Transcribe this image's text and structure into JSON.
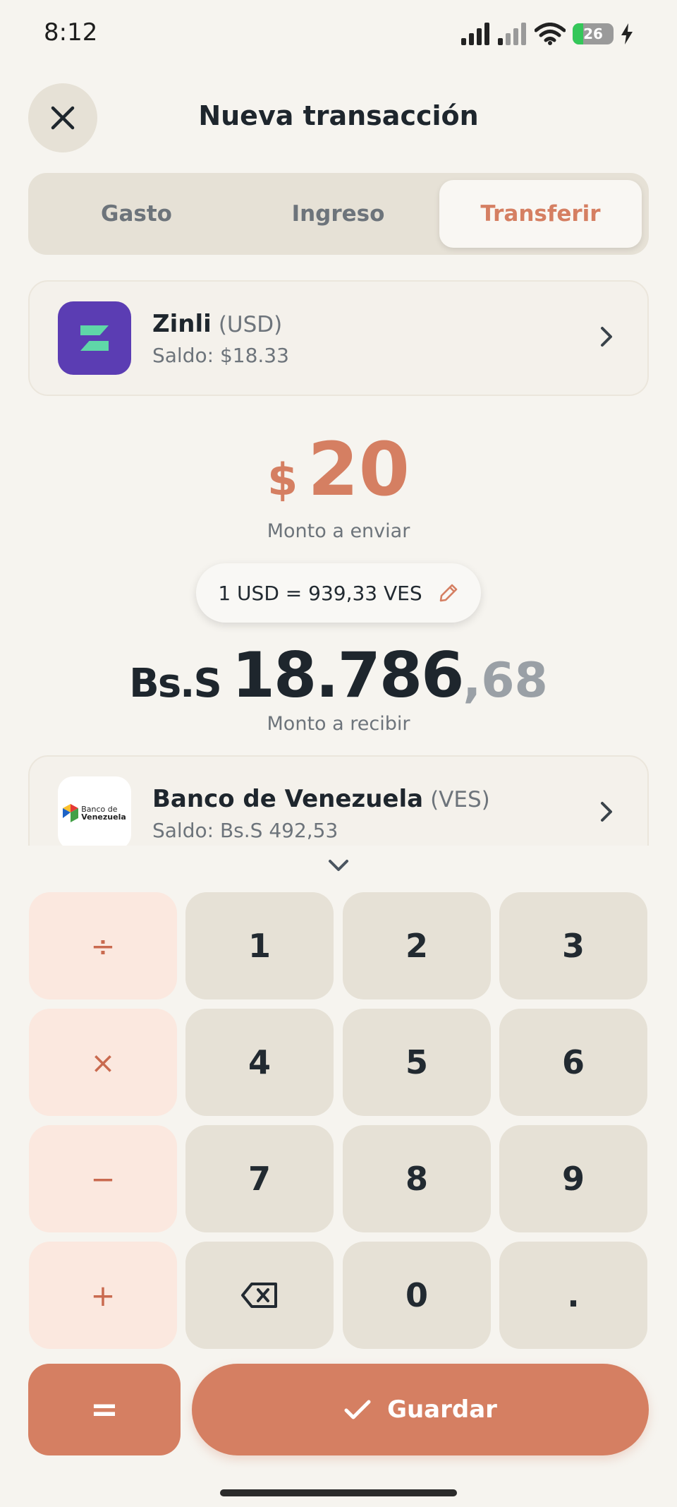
{
  "status_bar": {
    "time": "8:12",
    "battery": "26",
    "battery_level": 0.26
  },
  "header": {
    "title": "Nueva transacción"
  },
  "tabs": [
    {
      "label": "Gasto",
      "active": false
    },
    {
      "label": "Ingreso",
      "active": false
    },
    {
      "label": "Transferir",
      "active": true
    }
  ],
  "from_account": {
    "name": "Zinli",
    "currency": "(USD)",
    "balance": "Saldo: $18.33",
    "logo_letter": "Z",
    "logo_bg": "#5b3db3",
    "logo_fg": "#5fd7a8"
  },
  "send": {
    "symbol": "$",
    "amount": "20",
    "label": "Monto a enviar"
  },
  "rate": {
    "text": "1 USD = 939,33 VES"
  },
  "receive": {
    "symbol": "Bs.S",
    "integer": "18.786",
    "decimal": ",68",
    "label": "Monto a recibir"
  },
  "to_account": {
    "name": "Banco de Venezuela",
    "currency": "(VES)",
    "balance": "Saldo: Bs.S 492,53",
    "logo_line1": "Banco de",
    "logo_line2": "Venezuela"
  },
  "keypad": {
    "rows": [
      [
        "÷",
        "1",
        "2",
        "3"
      ],
      [
        "×",
        "4",
        "5",
        "6"
      ],
      [
        "−",
        "7",
        "8",
        "9"
      ],
      [
        "+",
        "backspace",
        "0",
        "."
      ]
    ],
    "equals": "=",
    "save": "Guardar"
  },
  "colors": {
    "accent": "#d57f62",
    "key_bg": "#e6e1d6",
    "op_bg": "#fbe8df",
    "page_bg": "#f6f4ef"
  }
}
